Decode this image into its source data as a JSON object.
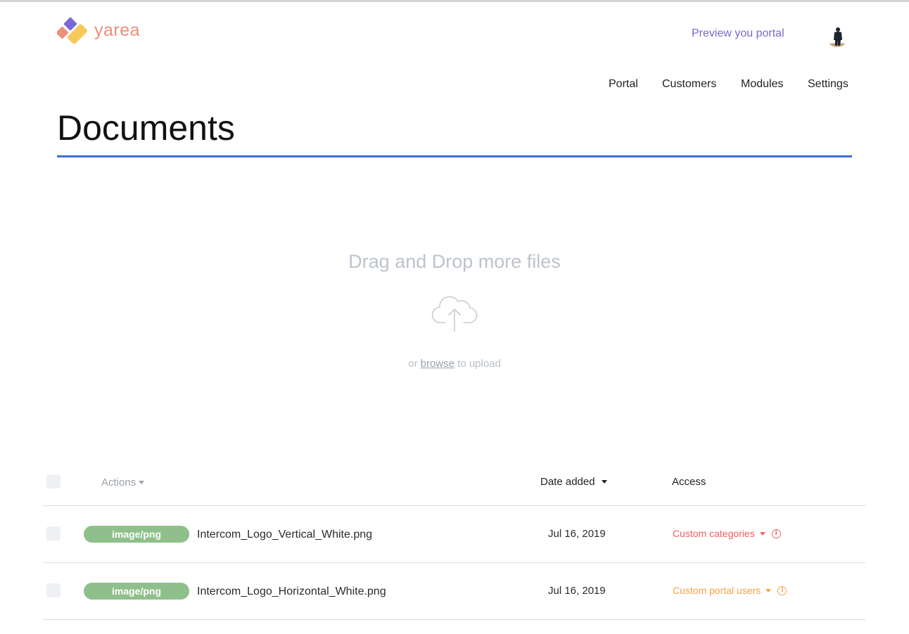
{
  "brand": {
    "name": "yarea",
    "colors": {
      "purple": "#7b68d6",
      "coral": "#ee8f7a",
      "yellow": "#f6c95a"
    }
  },
  "header": {
    "preview_link": "Preview you portal"
  },
  "nav": {
    "items": [
      {
        "label": "Portal"
      },
      {
        "label": "Customers"
      },
      {
        "label": "Modules"
      },
      {
        "label": "Settings"
      }
    ]
  },
  "page": {
    "title": "Documents",
    "accent_color": "#3f6bd6"
  },
  "dropzone": {
    "title": "Drag and Drop more files",
    "icon": "cloud-upload-icon",
    "sub_prefix": "or",
    "browse": "browse",
    "sub_suffix": "to upload"
  },
  "table": {
    "headers": {
      "actions": "Actions",
      "date_added": "Date added",
      "access": "Access"
    },
    "rows": [
      {
        "type": "image/png",
        "filename": "Intercom_Logo_Vertical_White.png",
        "date": "Jul 16, 2019",
        "access": "Custom categories",
        "access_color": "#ef5f5f"
      },
      {
        "type": "image/png",
        "filename": "Intercom_Logo_Horizontal_White.png",
        "date": "Jul 16, 2019",
        "access": "Custom portal users",
        "access_color": "#f5a04a"
      }
    ]
  }
}
